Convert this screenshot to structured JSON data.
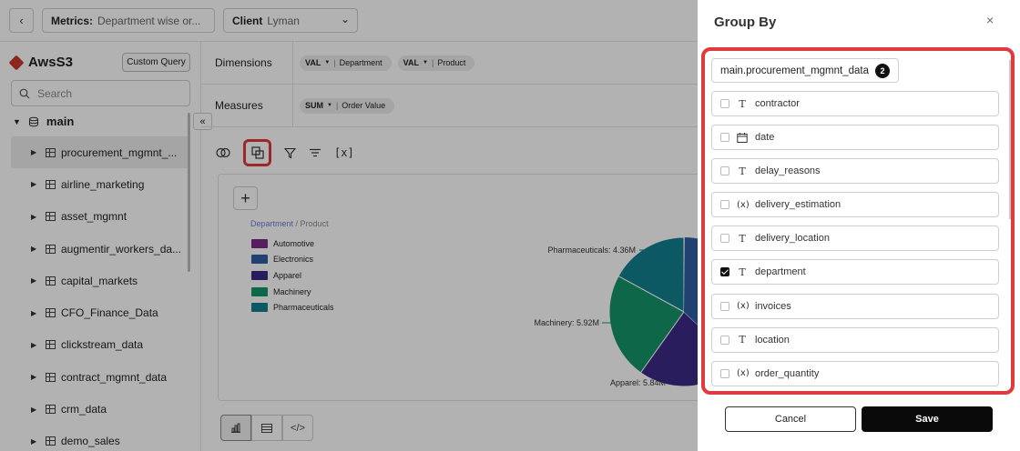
{
  "topbar": {
    "back": "‹",
    "metrics_key": "Metrics:",
    "metrics_value": "Department wise or...",
    "client_key": "Client",
    "client_value": "Lyman"
  },
  "sidebar": {
    "source": "AwsS3",
    "custom_query": "Custom Query",
    "search_placeholder": "Search",
    "root": "main",
    "tables": [
      "procurement_mgmnt_...",
      "airline_marketing",
      "asset_mgmnt",
      "augmentir_workers_da...",
      "capital_markets",
      "CFO_Finance_Data",
      "clickstream_data",
      "contract_mgmnt_data",
      "crm_data",
      "demo_sales"
    ]
  },
  "query": {
    "dimensions_label": "Dimensions",
    "dimensions": [
      {
        "agg": "VAL",
        "field": "Department"
      },
      {
        "agg": "VAL",
        "field": "Product"
      }
    ],
    "measures_label": "Measures",
    "measures": [
      {
        "agg": "SUM",
        "field": "Order Value"
      }
    ]
  },
  "toolbar": {
    "variables_icon": "[x]"
  },
  "chart_data": {
    "type": "pie",
    "legend_title_primary": "Department",
    "legend_title_secondary": "/ Product",
    "legend": [
      {
        "name": "Automotive",
        "color": "#7b2a8c"
      },
      {
        "name": "Electronics",
        "color": "#2f5ea3"
      },
      {
        "name": "Apparel",
        "color": "#3b2a86"
      },
      {
        "name": "Machinery",
        "color": "#149467"
      },
      {
        "name": "Pharmaceuticals",
        "color": "#12808f"
      }
    ],
    "slices": [
      {
        "name": "Pharmaceuticals",
        "label": "Pharmaceuticals: 4.36M",
        "value": 4.36,
        "color": "#12808f"
      },
      {
        "name": "Machinery",
        "label": "Machinery: 5.92M",
        "value": 5.92,
        "color": "#149467"
      },
      {
        "name": "Apparel",
        "label": "Apparel: 5.84M",
        "value": 5.84,
        "color": "#3b2a86"
      }
    ]
  },
  "drawer": {
    "title": "Group By",
    "close": "×",
    "table_name": "main.procurement_mgmnt_data",
    "selected_count": "2",
    "columns": [
      {
        "name": "contractor",
        "type": "text",
        "checked": false
      },
      {
        "name": "date",
        "type": "date",
        "checked": false
      },
      {
        "name": "delay_reasons",
        "type": "text",
        "checked": false
      },
      {
        "name": "delivery_estimation",
        "type": "number",
        "checked": false
      },
      {
        "name": "delivery_location",
        "type": "text",
        "checked": false
      },
      {
        "name": "department",
        "type": "text",
        "checked": true
      },
      {
        "name": "invoices",
        "type": "number",
        "checked": false
      },
      {
        "name": "location",
        "type": "text",
        "checked": false
      },
      {
        "name": "order_quantity",
        "type": "number",
        "checked": false
      }
    ],
    "cancel_label": "Cancel",
    "save_label": "Save"
  }
}
